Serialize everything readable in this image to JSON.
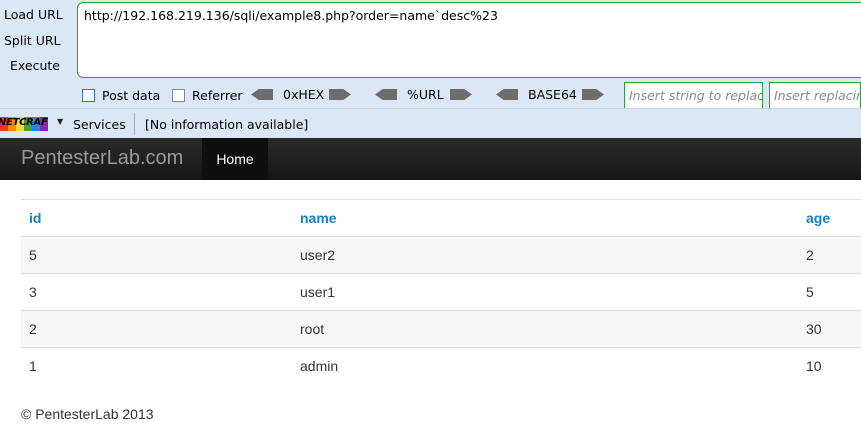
{
  "hackbar": {
    "load_url": "Load URL",
    "split_url": "Split URL",
    "execute": "Execute",
    "url": "http://192.168.219.136/sqli/example8.php?order=name`desc%23",
    "post_data": "Post data",
    "referrer": "Referrer",
    "hex": "0xHEX",
    "url_enc": "%URL",
    "base64": "BASE64",
    "replace_placeholder": "Insert string to replace",
    "replacing_placeholder": "Insert replacing string"
  },
  "netcraft": {
    "logo": "NETCRAFT",
    "services": "Services",
    "info": "[No information available]"
  },
  "navbar": {
    "brand": "PentesterLab.com",
    "home": "Home"
  },
  "table": {
    "headers": [
      "id",
      "name",
      "age"
    ],
    "rows": [
      [
        "5",
        "user2",
        "2"
      ],
      [
        "3",
        "user1",
        "5"
      ],
      [
        "2",
        "root",
        "30"
      ],
      [
        "1",
        "admin",
        "10"
      ]
    ]
  },
  "footer": "© PentesterLab 2013"
}
